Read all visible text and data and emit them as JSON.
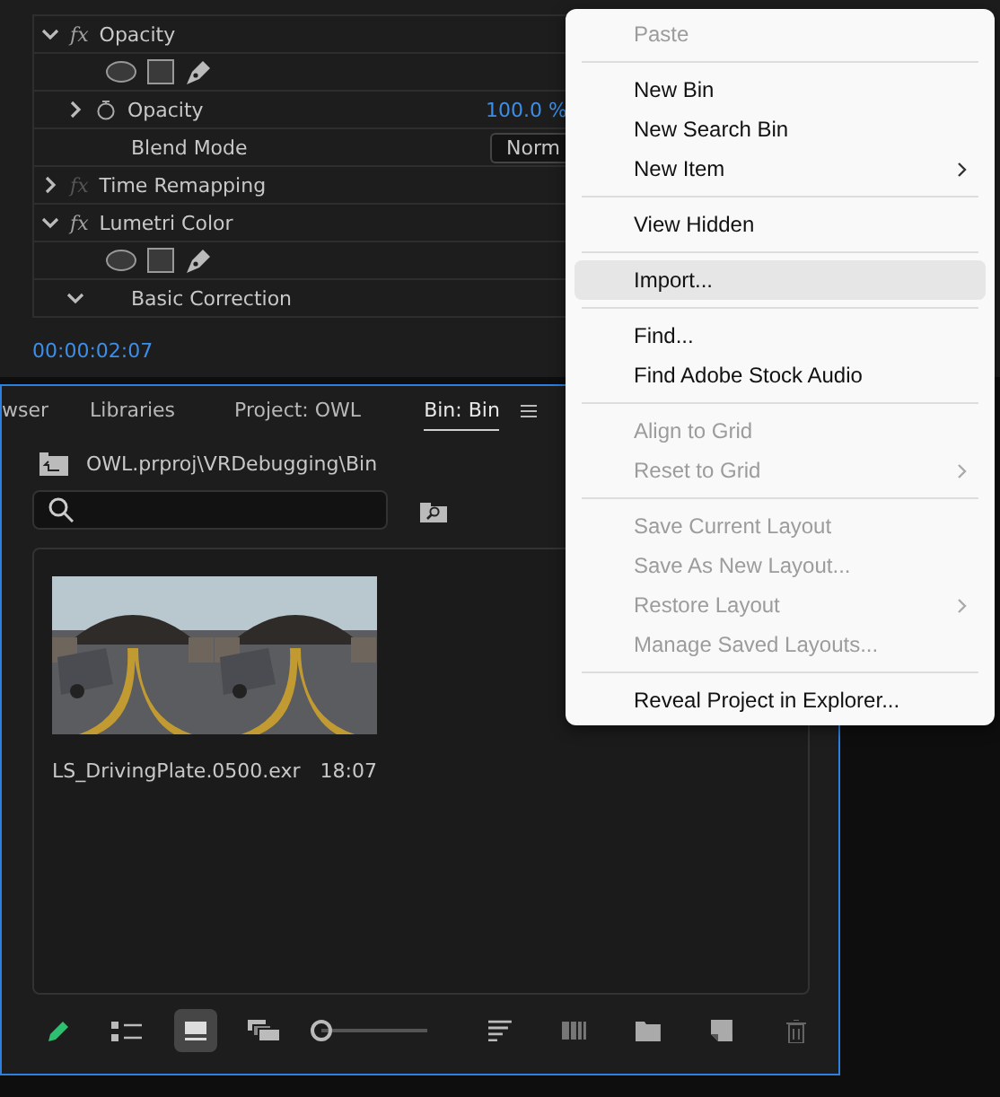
{
  "effect_controls": {
    "rows": [
      {
        "kind": "effect",
        "fx": "fx",
        "label": "Opacity",
        "expanded": true,
        "fx_enabled": true
      },
      {
        "kind": "mask_tools"
      },
      {
        "kind": "param",
        "label": "Opacity",
        "value": "100.0 %",
        "expanded": false
      },
      {
        "kind": "dropdown",
        "label": "Blend Mode",
        "value": "Norm"
      },
      {
        "kind": "effect",
        "fx": "fx",
        "label": "Time Remapping",
        "expanded": false,
        "fx_enabled": false
      },
      {
        "kind": "effect",
        "fx": "fx",
        "label": "Lumetri Color",
        "expanded": true,
        "fx_enabled": true
      },
      {
        "kind": "mask_tools"
      },
      {
        "kind": "group",
        "label": "Basic Correction",
        "expanded": true
      }
    ],
    "timecode": "00:00:02:07"
  },
  "project_panel": {
    "tabs": [
      {
        "label": "wser",
        "selected": false
      },
      {
        "label": "Libraries",
        "selected": false
      },
      {
        "label": "Project: OWL",
        "selected": false
      },
      {
        "label": "Bin: Bin",
        "selected": true
      }
    ],
    "path": "OWL.prproj\\VRDebugging\\Bin",
    "items": [
      {
        "kind": "picture",
        "name": "LS_DrivingPlate.0500.exr",
        "duration": "18:07"
      }
    ],
    "toolbar": {
      "view_buttons": [
        {
          "kind": "list",
          "selected": false
        },
        {
          "kind": "icon",
          "selected": true
        },
        {
          "kind": "freeform",
          "selected": false
        }
      ],
      "zoom": {
        "level": 0
      }
    }
  },
  "context_menu": {
    "items": [
      {
        "kind": "item",
        "label": "Paste",
        "disabled": true,
        "submenu": false,
        "selected": false
      },
      {
        "kind": "separator"
      },
      {
        "kind": "item",
        "label": "New Bin",
        "disabled": false,
        "submenu": false,
        "selected": false
      },
      {
        "kind": "item",
        "label": "New Search Bin",
        "disabled": false,
        "submenu": false,
        "selected": false
      },
      {
        "kind": "item",
        "label": "New Item",
        "disabled": false,
        "submenu": true,
        "selected": false
      },
      {
        "kind": "separator"
      },
      {
        "kind": "item",
        "label": "View Hidden",
        "disabled": false,
        "submenu": false,
        "selected": false
      },
      {
        "kind": "separator"
      },
      {
        "kind": "item",
        "label": "Import...",
        "disabled": false,
        "submenu": false,
        "selected": true
      },
      {
        "kind": "separator"
      },
      {
        "kind": "item",
        "label": "Find...",
        "disabled": false,
        "submenu": false,
        "selected": false
      },
      {
        "kind": "item",
        "label": "Find Adobe Stock Audio",
        "disabled": false,
        "submenu": false,
        "selected": false
      },
      {
        "kind": "separator"
      },
      {
        "kind": "item",
        "label": "Align to Grid",
        "disabled": true,
        "submenu": false,
        "selected": false
      },
      {
        "kind": "item",
        "label": "Reset to Grid",
        "disabled": true,
        "submenu": true,
        "selected": false
      },
      {
        "kind": "separator"
      },
      {
        "kind": "item",
        "label": "Save Current Layout",
        "disabled": true,
        "submenu": false,
        "selected": false
      },
      {
        "kind": "item",
        "label": "Save As New Layout...",
        "disabled": true,
        "submenu": false,
        "selected": false
      },
      {
        "kind": "item",
        "label": "Restore Layout",
        "disabled": true,
        "submenu": true,
        "selected": false
      },
      {
        "kind": "item",
        "label": "Manage Saved Layouts...",
        "disabled": true,
        "submenu": false,
        "selected": false
      },
      {
        "kind": "separator"
      },
      {
        "kind": "item",
        "label": "Reveal Project in Explorer...",
        "disabled": false,
        "submenu": false,
        "selected": false
      }
    ]
  }
}
